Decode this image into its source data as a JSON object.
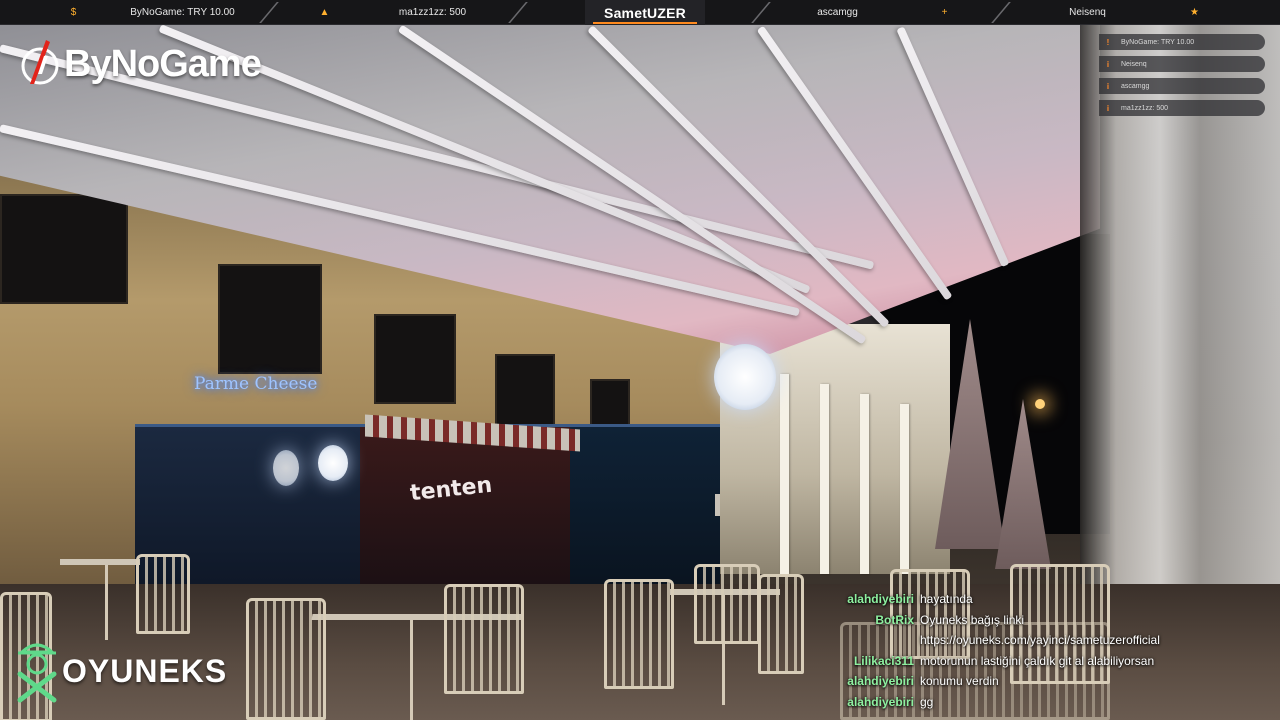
{
  "colors": {
    "accent": "#ff8a1e",
    "chat_user": "#8ef0a0",
    "oyuneks_green": "#5fd98a",
    "bynogame_red": "#e2231a"
  },
  "topbar": {
    "segments": [
      {
        "icon": "dollar-icon",
        "glyph": "$",
        "label": "ByNoGame: TRY 10.00"
      },
      {
        "icon": "fire-icon",
        "glyph": "▲",
        "label": "ma1zz1zz: 500"
      },
      {
        "icon": "plus-icon",
        "glyph": "+",
        "label": "ascamgg"
      },
      {
        "icon": "star-icon",
        "glyph": "★",
        "label": "Neisenq"
      }
    ],
    "center_title": "SametUZER"
  },
  "bynogame_logo": {
    "text": "ByNoGame"
  },
  "alerts": [
    {
      "glyph": "!",
      "text": "ByNoGame: TRY 10.00"
    },
    {
      "glyph": "i",
      "text": "Neisenq"
    },
    {
      "glyph": "i",
      "text": "ascamgg"
    },
    {
      "glyph": "i",
      "text": "ma1zz1zz: 500"
    }
  ],
  "scene": {
    "shop_sign": "Parme Cheese",
    "storefront_sign": "tenten"
  },
  "oyuneks_logo": {
    "text": "OYUNEKS"
  },
  "chat": {
    "messages": [
      {
        "user": "alahdiyebiri",
        "text": "hayatında"
      },
      {
        "user": "BotRix",
        "text": "Oyuneks bağış linki"
      },
      {
        "user": "",
        "text": "https://oyuneks.com/yayinci/sametuzerofficial"
      },
      {
        "user": "Lilikaci311",
        "text": "motorunun lastiğini çaldık git al alabiliyorsan"
      },
      {
        "user": "alahdiyebiri",
        "text": "konumu verdin"
      },
      {
        "user": "alahdiyebiri",
        "text": "gg"
      }
    ]
  }
}
